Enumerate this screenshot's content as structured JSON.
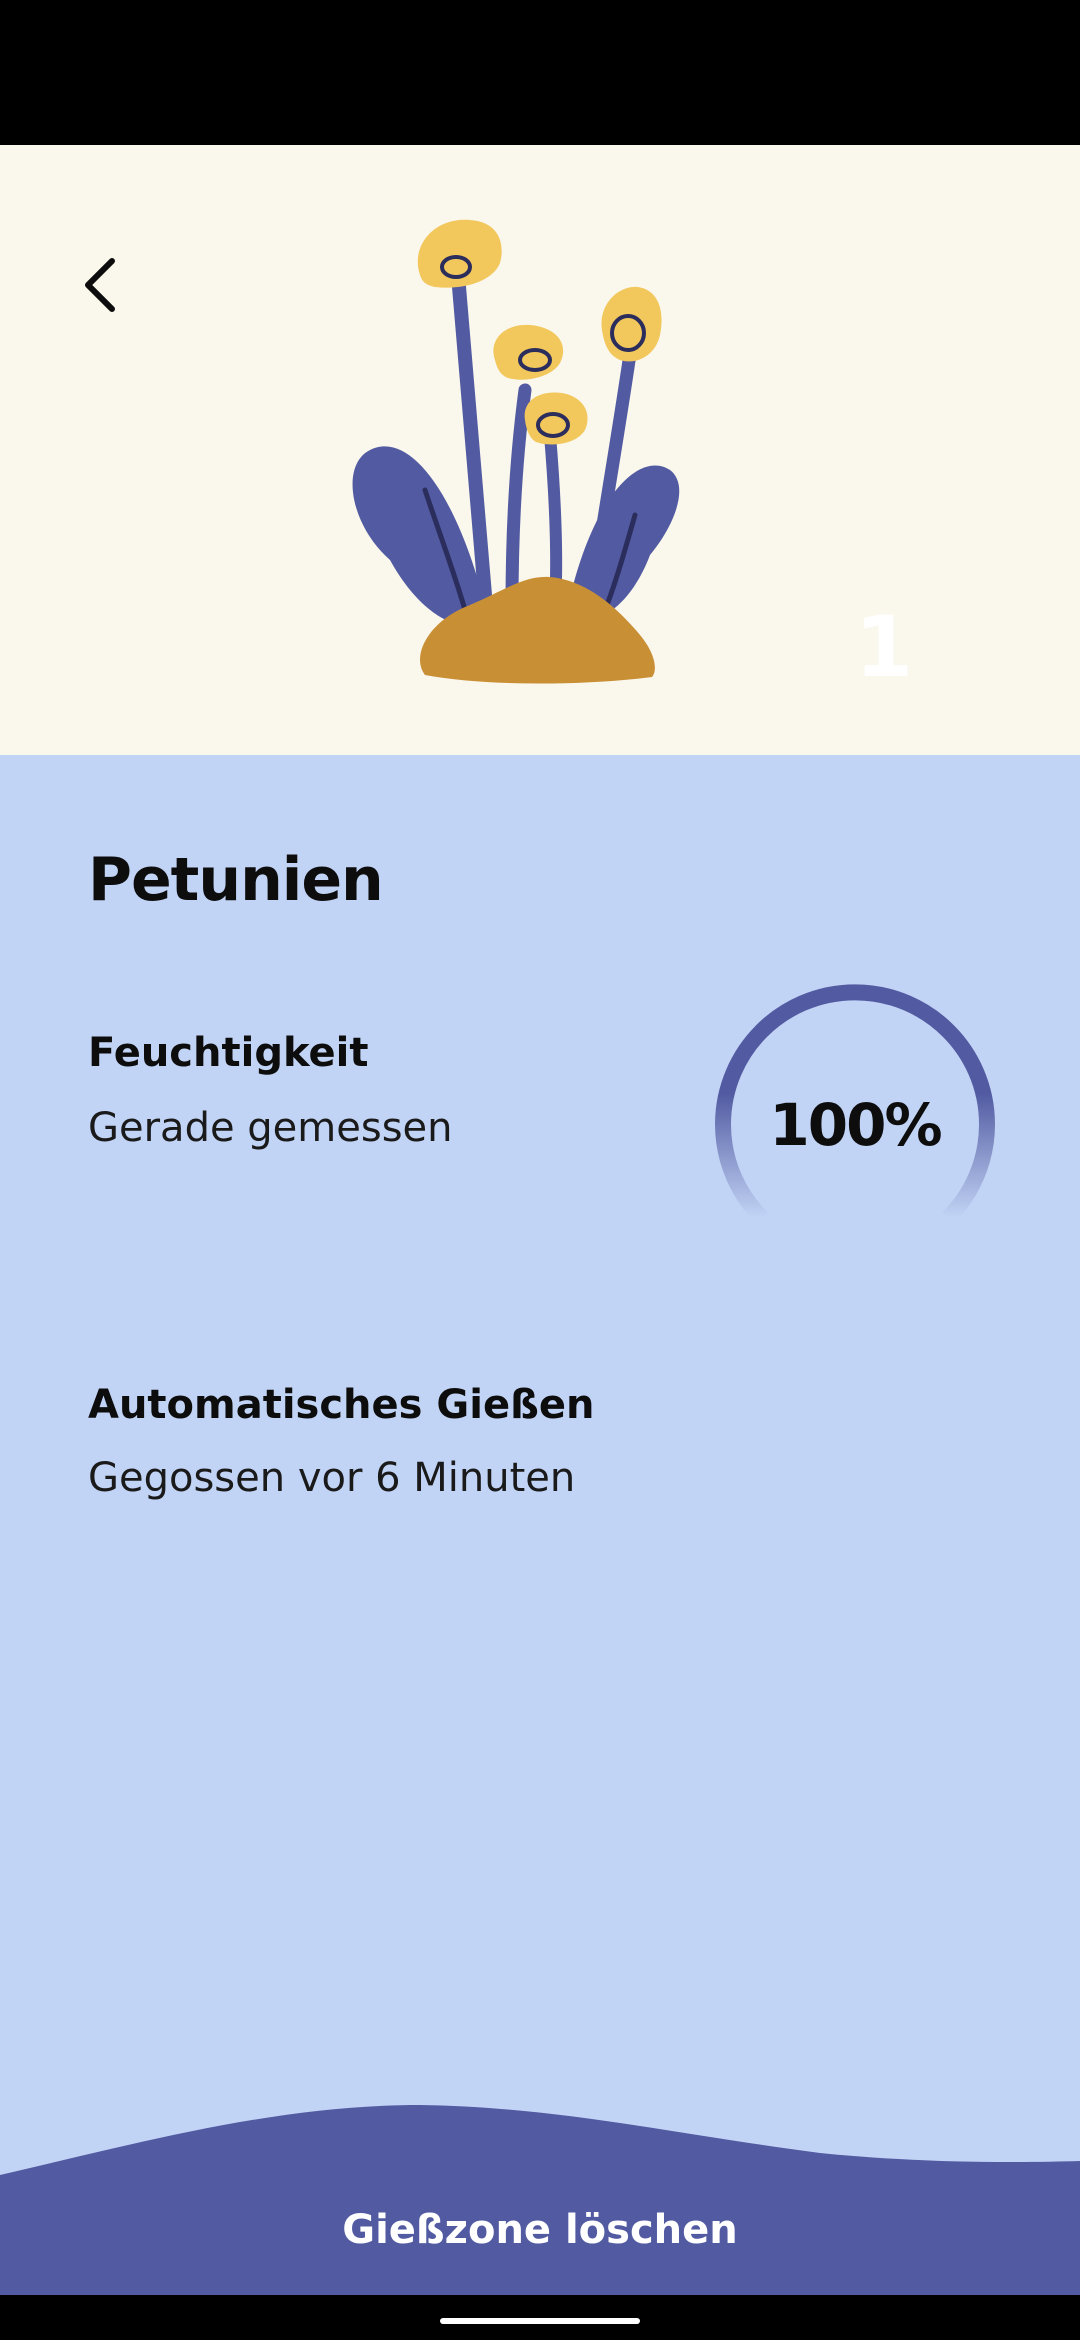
{
  "hero": {
    "zone_number": "1"
  },
  "plant": {
    "name": "Petunien"
  },
  "moisture": {
    "label": "Feuchtigkeit",
    "status": "Gerade gemessen",
    "value_text": "100%",
    "value_fraction": 1.0
  },
  "watering": {
    "label": "Automatisches Gießen",
    "status": "Gegossen vor 6 Minuten"
  },
  "actions": {
    "delete_zone_label": "Gießzone löschen"
  },
  "icons": {
    "back": "chevron-left-icon",
    "plant": "plant-illustration"
  },
  "colors": {
    "hero_background": "#faf7ec",
    "content_background": "#c2d4f5",
    "accent_indigo": "#525ba2",
    "flower_yellow": "#f2c75c",
    "soil_ochre": "#c98f35"
  }
}
